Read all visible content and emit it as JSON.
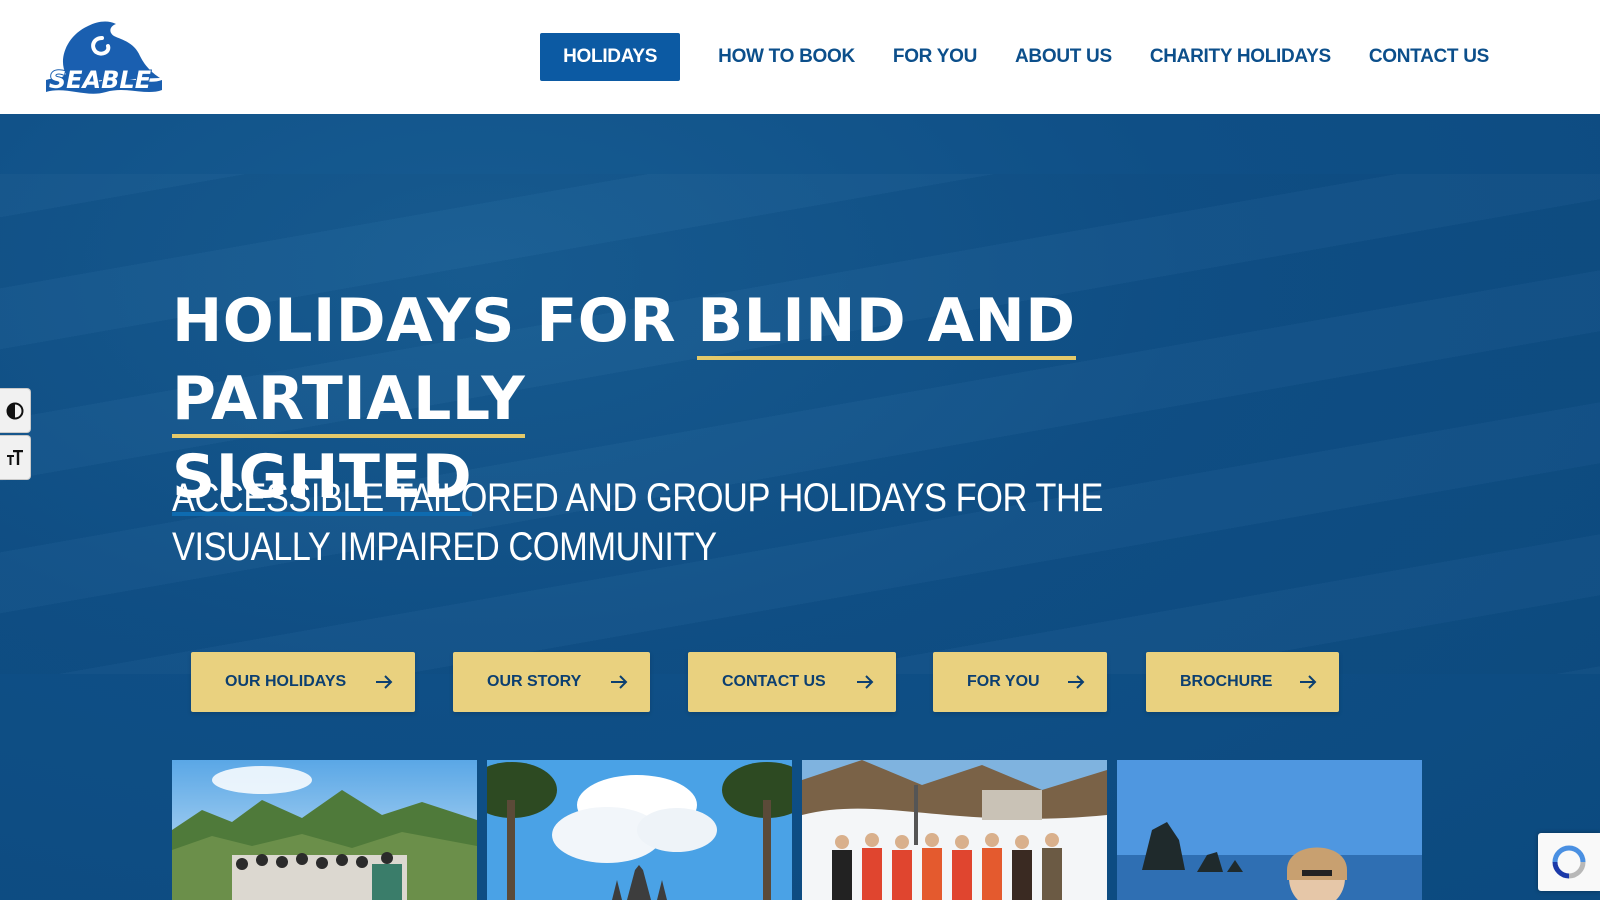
{
  "header": {
    "logo_text": "SEABLE",
    "nav": [
      {
        "label": "HOLIDAYS",
        "active": true
      },
      {
        "label": "HOW TO BOOK",
        "active": false
      },
      {
        "label": "FOR YOU",
        "active": false
      },
      {
        "label": "ABOUT US",
        "active": false
      },
      {
        "label": "CHARITY HOLIDAYS",
        "active": false
      },
      {
        "label": "CONTACT US",
        "active": false
      }
    ]
  },
  "hero": {
    "title_part1": "HOLIDAYS FOR ",
    "title_highlight": "BLIND AND PARTIALLY",
    "title_highlight2": "SIGHTED",
    "subtitle": "ACCESSIBLE TAILORED AND GROUP HOLIDAYS FOR THE VISUALLY IMPAIRED COMMUNITY",
    "buttons": [
      {
        "label": "OUR HOLIDAYS"
      },
      {
        "label": "OUR STORY"
      },
      {
        "label": "CONTACT US"
      },
      {
        "label": "FOR YOU"
      },
      {
        "label": "BROCHURE"
      }
    ]
  },
  "photos": [
    {
      "alt": "group-on-mountain-lookout"
    },
    {
      "alt": "palm-trees-temple"
    },
    {
      "alt": "ski-group-snow"
    },
    {
      "alt": "woman-by-sea-stacks"
    }
  ],
  "accessibility_toolbar": {
    "contrast_icon": "contrast-icon",
    "text_size_icon": "text-size-icon"
  },
  "colors": {
    "brand_blue": "#0c4f8b",
    "hero_blue": "#0f4f86",
    "accent_yellow": "#e9d17f"
  }
}
